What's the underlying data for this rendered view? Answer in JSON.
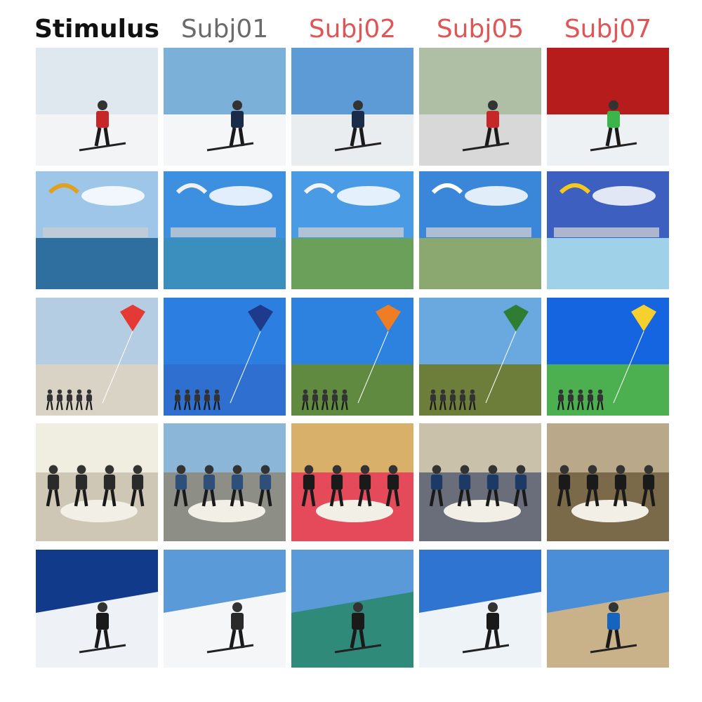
{
  "headers": [
    {
      "label": "Stimulus",
      "color": "#111111",
      "weight": "bold"
    },
    {
      "label": "Subj01",
      "color": "#6b6b6b",
      "weight": "normal"
    },
    {
      "label": "Subj02",
      "color": "#e05555",
      "weight": "normal"
    },
    {
      "label": "Subj05",
      "color": "#e05555",
      "weight": "normal"
    },
    {
      "label": "Subj07",
      "color": "#e05555",
      "weight": "normal"
    }
  ],
  "rows": [
    {
      "scene": "skier-snow",
      "cells": [
        {
          "sky": "#dfe8ee",
          "ground": "#f2f4f6",
          "figure": "#c62828"
        },
        {
          "sky": "#7bb0d8",
          "ground": "#f4f6f8",
          "figure": "#1b2b4a"
        },
        {
          "sky": "#5c9bd6",
          "ground": "#e9edf0",
          "figure": "#1b2b4a"
        },
        {
          "sky": "#aebfa6",
          "ground": "#d8d8d8",
          "figure": "#c62828"
        },
        {
          "sky": "#b71c1c",
          "ground": "#eef1f4",
          "figure": "#3bb54a"
        }
      ]
    },
    {
      "scene": "kites-sea",
      "cells": [
        {
          "sky": "#9ec6e8",
          "ground": "#2f6f9f",
          "figure": "#e0a020"
        },
        {
          "sky": "#3d8fe0",
          "ground": "#3a8fbf",
          "figure": "#f0f0f0"
        },
        {
          "sky": "#4a9be6",
          "ground": "#6aa05a",
          "figure": "#f4f4f4"
        },
        {
          "sky": "#3a86d8",
          "ground": "#8aa870",
          "figure": "#ffffff"
        },
        {
          "sky": "#3d5fbf",
          "ground": "#9fd2e8",
          "figure": "#f6c81e"
        }
      ]
    },
    {
      "scene": "kites-beach",
      "cells": [
        {
          "sky": "#b4cde2",
          "ground": "#d9d3c6",
          "figure": "#e53935"
        },
        {
          "sky": "#2c7fe0",
          "ground": "#2f6fd0",
          "figure": "#1e3a8a"
        },
        {
          "sky": "#2c82de",
          "ground": "#5f8a3f",
          "figure": "#ef7d23"
        },
        {
          "sky": "#6aa8e0",
          "ground": "#6d7d3a",
          "figure": "#2e7d32"
        },
        {
          "sky": "#1565e0",
          "ground": "#4caf50",
          "figure": "#f6d02e"
        }
      ]
    },
    {
      "scene": "people-dining",
      "cells": [
        {
          "sky": "#f0eee0",
          "ground": "#cfc7b5",
          "figure": "#2a2a2a"
        },
        {
          "sky": "#8cb6d8",
          "ground": "#8d8f86",
          "figure": "#2e4f7a"
        },
        {
          "sky": "#d9b06a",
          "ground": "#e44a5a",
          "figure": "#1a1a1a"
        },
        {
          "sky": "#c9c1aa",
          "ground": "#6a6e7a",
          "figure": "#1d3a66"
        },
        {
          "sky": "#b9a98a",
          "ground": "#7a6a4a",
          "figure": "#1a1a1a"
        }
      ]
    },
    {
      "scene": "skier-slope",
      "cells": [
        {
          "sky": "#123a8a",
          "ground": "#eef2f6",
          "figure": "#1a1a1a"
        },
        {
          "sky": "#5a9ad8",
          "ground": "#f4f6f8",
          "figure": "#2a2a2a"
        },
        {
          "sky": "#5a9ad8",
          "ground": "#2f8a7a",
          "figure": "#1a1a1a"
        },
        {
          "sky": "#2f74d0",
          "ground": "#eef3f7",
          "figure": "#1a1a1a"
        },
        {
          "sky": "#4a8ed8",
          "ground": "#c9b28a",
          "figure": "#1565c0"
        }
      ]
    }
  ]
}
